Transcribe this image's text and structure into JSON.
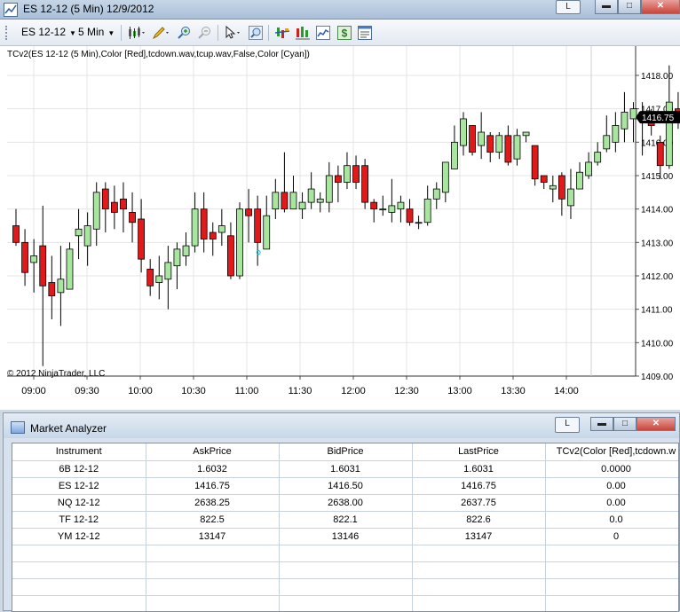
{
  "chart_window": {
    "title": "ES 12-12 (5 Min)  12/9/2012",
    "buttons": {
      "link": "L",
      "minimize": "▬",
      "maximize": "□",
      "close": "✕"
    },
    "toolbar": {
      "instrument": "ES 12-12",
      "interval": "5 Min"
    },
    "indicator_label": "TCv2(ES 12-12 (5 Min),Color [Red],tcdown.wav,tcup.wav,False,Color [Cyan])",
    "copyright": "© 2012 NinjaTrader, LLC",
    "last_price_label": "1416.75",
    "colors": {
      "up": "#a8e6a0",
      "down": "#e0191b",
      "last_price_bg": "#000000",
      "signal": "#00c8d8"
    }
  },
  "chart_data": {
    "type": "candlestick",
    "x_ticks": [
      "09:00",
      "09:30",
      "10:00",
      "10:30",
      "11:00",
      "11:30",
      "12:00",
      "12:30",
      "13:00",
      "13:30",
      "14:00"
    ],
    "y_ticks": [
      "1418.00",
      "1417.00",
      "1416.00",
      "1415.00",
      "1414.00",
      "1413.00",
      "1412.00",
      "1411.00",
      "1410.00",
      "1409.00"
    ],
    "ylim": [
      1409,
      1418.9
    ],
    "grid": true,
    "candles": [
      [
        1413.5,
        1413,
        1414,
        1412.9
      ],
      [
        1413,
        1412.1,
        1413.4,
        1411.7
      ],
      [
        1412.4,
        1412.6,
        1413.1,
        1411.5
      ],
      [
        1412.9,
        1411.7,
        1414.1,
        1409.3
      ],
      [
        1411.8,
        1411.4,
        1412.6,
        1410.7
      ],
      [
        1411.5,
        1411.9,
        1412.9,
        1410.5
      ],
      [
        1411.6,
        1412.8,
        1413,
        1411.6
      ],
      [
        1413.2,
        1413.4,
        1414,
        1412.5
      ],
      [
        1412.9,
        1413.5,
        1413.9,
        1412.3
      ],
      [
        1413.4,
        1414.5,
        1414.8,
        1412.9
      ],
      [
        1414.6,
        1414,
        1414.8,
        1413.3
      ],
      [
        1414.2,
        1413.9,
        1414.7,
        1413.4
      ],
      [
        1414.3,
        1414,
        1414.8,
        1413.3
      ],
      [
        1413.9,
        1413.6,
        1414.5,
        1413
      ],
      [
        1413.7,
        1412.5,
        1414.3,
        1412.1
      ],
      [
        1412.2,
        1411.7,
        1412.5,
        1411.4
      ],
      [
        1411.8,
        1412.0,
        1412.6,
        1411.3
      ],
      [
        1411.9,
        1412.4,
        1412.9,
        1411.0
      ],
      [
        1412.3,
        1412.8,
        1413.0,
        1411.6
      ],
      [
        1412.6,
        1412.9,
        1413.3,
        1412.3
      ],
      [
        1412.9,
        1414.0,
        1414.5,
        1412.7
      ],
      [
        1414.0,
        1413.1,
        1414.5,
        1412.7
      ],
      [
        1413.3,
        1413.1,
        1413.6,
        1412.6
      ],
      [
        1413.3,
        1413.5,
        1414.0,
        1412.9
      ],
      [
        1413.2,
        1412.0,
        1413.6,
        1411.9
      ],
      [
        1412.0,
        1414.0,
        1414.2,
        1411.9
      ],
      [
        1414.0,
        1413.8,
        1414.6,
        1413.0
      ],
      [
        1414.0,
        1413.0,
        1414.4,
        1412.3
      ],
      [
        1412.8,
        1413.8,
        1414.4,
        1412.8
      ],
      [
        1414.0,
        1414.5,
        1414.9,
        1413.7
      ],
      [
        1414.5,
        1414.0,
        1415.7,
        1413.9
      ],
      [
        1414.0,
        1414.5,
        1415.0,
        1414.3
      ],
      [
        1414.0,
        1414.2,
        1414.5,
        1413.7
      ],
      [
        1414.2,
        1414.6,
        1415.1,
        1414.0
      ],
      [
        1414.2,
        1414.3,
        1414.5,
        1413.9
      ],
      [
        1414.2,
        1415.0,
        1415.4,
        1413.9
      ],
      [
        1415.0,
        1414.8,
        1415.3,
        1414.2
      ],
      [
        1414.8,
        1415.3,
        1415.7,
        1414.6
      ],
      [
        1415.3,
        1414.8,
        1415.6,
        1414.6
      ],
      [
        1415.3,
        1414.2,
        1415.5,
        1414.0
      ],
      [
        1414.2,
        1414.0,
        1414.3,
        1413.6
      ],
      [
        1414.0,
        1414.0,
        1414.4,
        1413.8
      ],
      [
        1413.9,
        1414.1,
        1414.9,
        1413.6
      ],
      [
        1414.0,
        1414.2,
        1414.4,
        1413.6
      ],
      [
        1414.0,
        1413.6,
        1414.3,
        1413.5
      ],
      [
        1413.6,
        1413.6,
        1413.8,
        1413.4
      ],
      [
        1413.6,
        1414.3,
        1414.7,
        1413.5
      ],
      [
        1414.3,
        1414.6,
        1414.8,
        1414.0
      ],
      [
        1414.5,
        1415.4,
        1415.4,
        1414.2
      ],
      [
        1415.2,
        1416.0,
        1416.5,
        1415.2
      ],
      [
        1415.9,
        1416.7,
        1416.9,
        1415.6
      ],
      [
        1416.5,
        1415.7,
        1416.5,
        1415.6
      ],
      [
        1415.9,
        1416.3,
        1416.9,
        1415.5
      ],
      [
        1416.2,
        1415.7,
        1416.3,
        1415.4
      ],
      [
        1415.7,
        1416.2,
        1416.3,
        1415.5
      ],
      [
        1416.2,
        1415.4,
        1416.5,
        1415.3
      ],
      [
        1415.5,
        1416.2,
        1416.4,
        1415.3
      ],
      [
        1416.2,
        1416.3,
        1416.3,
        1416.0
      ],
      [
        1415.9,
        1414.9,
        1415.9,
        1414.7
      ],
      [
        1415.0,
        1414.8,
        1415.0,
        1414.6
      ],
      [
        1414.6,
        1414.7,
        1415.0,
        1414.2
      ],
      [
        1415.0,
        1414.3,
        1415.1,
        1413.8
      ],
      [
        1414.1,
        1414.6,
        1415.2,
        1413.7
      ],
      [
        1414.6,
        1415.1,
        1415.4,
        1414.6
      ],
      [
        1415.0,
        1415.4,
        1415.7,
        1414.9
      ],
      [
        1415.4,
        1415.7,
        1416.0,
        1415.3
      ],
      [
        1415.8,
        1416.2,
        1416.8,
        1415.7
      ],
      [
        1416.0,
        1416.5,
        1416.9,
        1415.7
      ],
      [
        1416.4,
        1416.9,
        1417.5,
        1416.0
      ],
      [
        1416.7,
        1417.0,
        1417.2,
        1416.0
      ],
      [
        1416.9,
        1416.8,
        1417.2,
        1415.6
      ],
      [
        1416.8,
        1416.5,
        1417.0,
        1416.2
      ],
      [
        1416.0,
        1415.3,
        1416.2,
        1414.9
      ],
      [
        1415.3,
        1417.2,
        1418.3,
        1415.2
      ],
      [
        1417.0,
        1416.9,
        1417.5,
        1416.4
      ],
      [
        1416.9,
        1416.75,
        1417.0,
        1416.5
      ]
    ],
    "signal_marker": {
      "index": 27,
      "value": 1412.7
    }
  },
  "market_analyzer": {
    "title": "Market Analyzer",
    "buttons": {
      "link": "L",
      "minimize": "▬",
      "maximize": "□",
      "close": "✕"
    },
    "columns": [
      "Instrument",
      "AskPrice",
      "BidPrice",
      "LastPrice",
      "TCv2(Color [Red],tcdown.w"
    ],
    "rows": [
      [
        "6B 12-12",
        "1.6032",
        "1.6031",
        "1.6031",
        "0.0000"
      ],
      [
        "ES 12-12",
        "1416.75",
        "1416.50",
        "1416.75",
        "0.00"
      ],
      [
        "NQ 12-12",
        "2638.25",
        "2638.00",
        "2637.75",
        "0.00"
      ],
      [
        "TF 12-12",
        "822.5",
        "822.1",
        "822.6",
        "0.0"
      ],
      [
        "YM 12-12",
        "13147",
        "13146",
        "13147",
        "0"
      ]
    ]
  }
}
